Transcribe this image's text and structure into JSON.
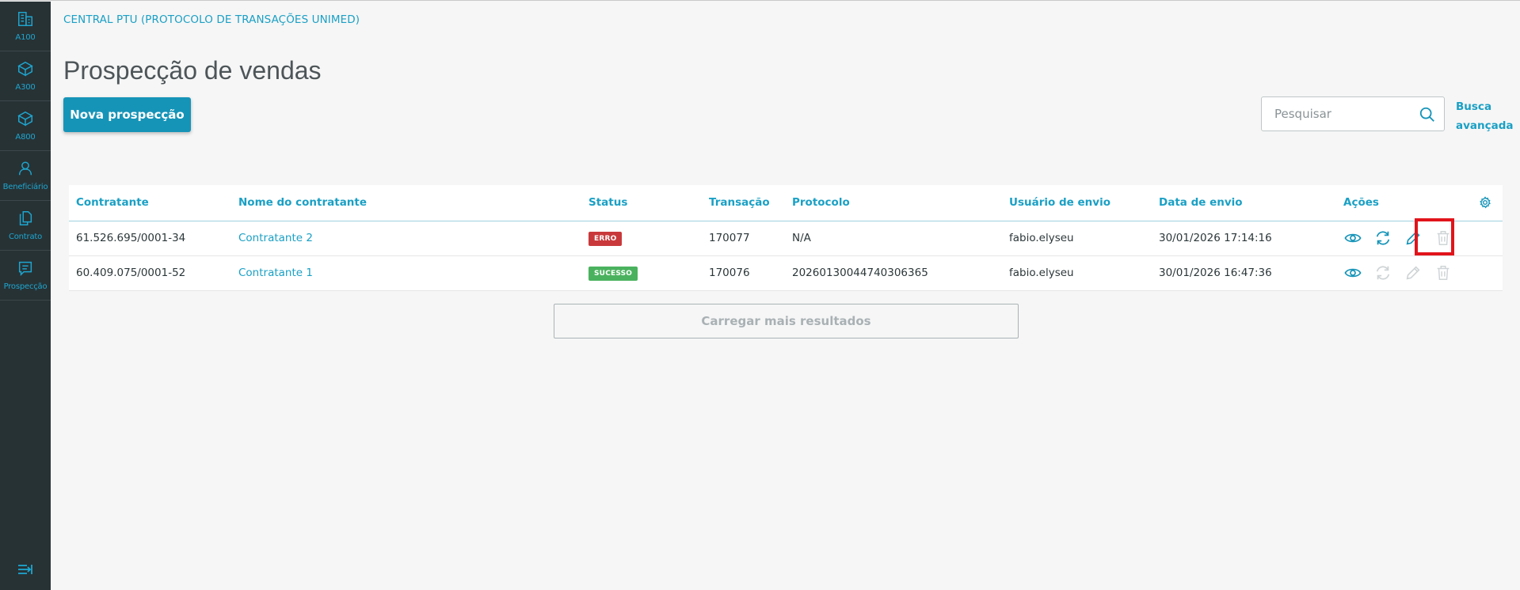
{
  "sidebar": {
    "items": [
      {
        "label": "A100",
        "icon": "building-icon"
      },
      {
        "label": "A300",
        "icon": "cube-icon"
      },
      {
        "label": "A800",
        "icon": "cube-icon"
      },
      {
        "label": "Beneficiário",
        "icon": "person-icon"
      },
      {
        "label": "Contrato",
        "icon": "documents-icon"
      },
      {
        "label": "Prospecção",
        "icon": "list-box-icon"
      }
    ],
    "collapse_icon": "expand-menu-icon"
  },
  "header": {
    "app_title": "CENTRAL PTU (PROTOCOLO DE TRANSAÇÕES UNIMED)",
    "page_title": "Prospecção de vendas",
    "new_button": "Nova prospecção",
    "search_placeholder": "Pesquisar",
    "advanced_search_line1": "Busca",
    "advanced_search_line2": "avançada"
  },
  "table": {
    "columns": [
      "Contratante",
      "Nome do contratante",
      "Status",
      "Transação",
      "Protocolo",
      "Usuário de envio",
      "Data de envio",
      "Ações"
    ],
    "rows": [
      {
        "contratante": "61.526.695/0001-34",
        "nome": "Contratante 2",
        "status": "ERRO",
        "transacao": "170077",
        "protocolo": "N/A",
        "usuario": "fabio.elyseu",
        "data": "30/01/2026 17:14:16"
      },
      {
        "contratante": "60.409.075/0001-52",
        "nome": "Contratante 1",
        "status": "SUCESSO",
        "transacao": "170076",
        "protocolo": "20260130044740306365",
        "usuario": "fabio.elyseu",
        "data": "30/01/2026 16:47:36"
      }
    ]
  },
  "load_more": "Carregar mais resultados",
  "colors": {
    "sidebar_bg": "#273235",
    "accent": "#1aa0c5",
    "primary_button": "#1694b8",
    "status_error": "#c9393b",
    "status_success": "#4ab25e",
    "highlight": "#e1141b"
  }
}
